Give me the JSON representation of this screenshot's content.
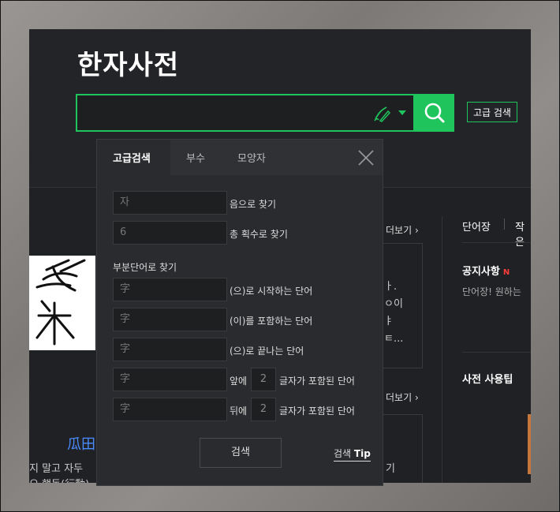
{
  "header": {
    "title": "한자사전",
    "search_placeholder": "",
    "advanced_button": "고급 검색",
    "handwriting_icon": "handwriting-brush-icon",
    "search_icon": "magnifier-icon"
  },
  "colors": {
    "accent": "#1fc45c",
    "new_badge": "#ff3b3b",
    "link": "#4a8cff"
  },
  "background": {
    "more_label_1": "더보기",
    "more_label_2": "더보기",
    "card_lines": [
      "ㅏ.",
      "ㅇ이",
      "ㅑ",
      "ㅌ..."
    ],
    "hanja_link": "瓜田",
    "bottom_lines": [
      "지 말고 자두",
      "오 행동(行動)"
    ],
    "bottom_right_char": "기",
    "right_tabs": [
      "단어장",
      "작은"
    ],
    "notice_title": "공지사항",
    "notice_badge": "N",
    "notice_sub": "단어장! 원하는",
    "tips_title": "사전 사용팁"
  },
  "popup": {
    "tabs": [
      {
        "label": "고급검색",
        "active": true
      },
      {
        "label": "부수",
        "active": false
      },
      {
        "label": "모양자",
        "active": false
      }
    ],
    "reading_field": {
      "value": "자",
      "label": "음으로 찾기"
    },
    "stroke_field": {
      "value": "6",
      "label": "총 획수로 찾기"
    },
    "section_label": "부분단어로 찾기",
    "starts_field": {
      "value": "字",
      "label": "(으)로 시작하는 단어"
    },
    "contains_field": {
      "value": "字",
      "label": "(이)를 포함하는 단어"
    },
    "ends_field": {
      "value": "字",
      "label": "(으)로 끝나는 단어"
    },
    "front_field": {
      "value": "字",
      "prefix": "앞에",
      "count": "2",
      "suffix": "글자가 포함된 단어"
    },
    "back_field": {
      "value": "字",
      "prefix": "뒤에",
      "count": "2",
      "suffix": "글자가 포함된 단어"
    },
    "submit_label": "검색",
    "tip_label": "검색",
    "tip_bold": "Tip"
  }
}
